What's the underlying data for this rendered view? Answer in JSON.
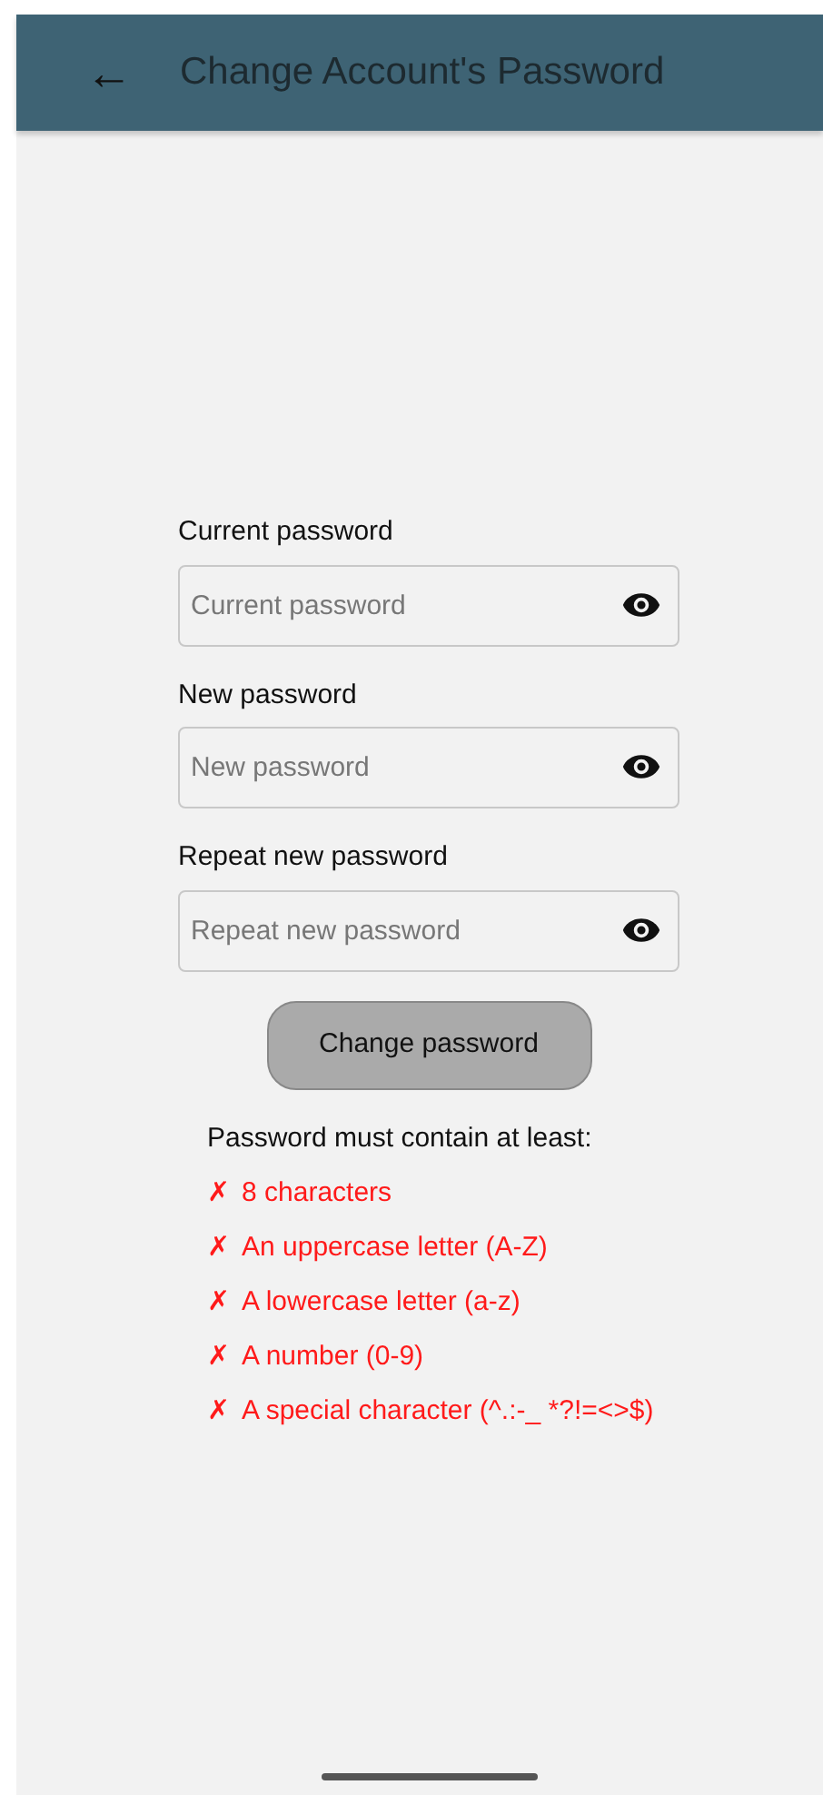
{
  "app_bar": {
    "back_icon": "←",
    "title": "Change Account's Password"
  },
  "fields": [
    {
      "label": "Current password",
      "placeholder": "Current password",
      "masked": true
    },
    {
      "label": "New password",
      "placeholder": "New password",
      "masked": true
    },
    {
      "label": "Repeat new password",
      "placeholder": "Repeat new password",
      "masked": true
    }
  ],
  "submit_button": {
    "label": "Change password",
    "disabled": true
  },
  "requirements": {
    "heading": "Password must contain at least:",
    "rules": [
      {
        "icon": "✗",
        "text": "8 characters",
        "met": false
      },
      {
        "icon": "✗",
        "text": "An uppercase letter (A-Z)",
        "met": false
      },
      {
        "icon": "✗",
        "text": "A lowercase letter (a-z)",
        "met": false
      },
      {
        "icon": "✗",
        "text": "A number (0-9)",
        "met": false
      },
      {
        "icon": "✗",
        "text": "A special character (^.:-_ *?!=<>$)",
        "met": false
      }
    ]
  }
}
